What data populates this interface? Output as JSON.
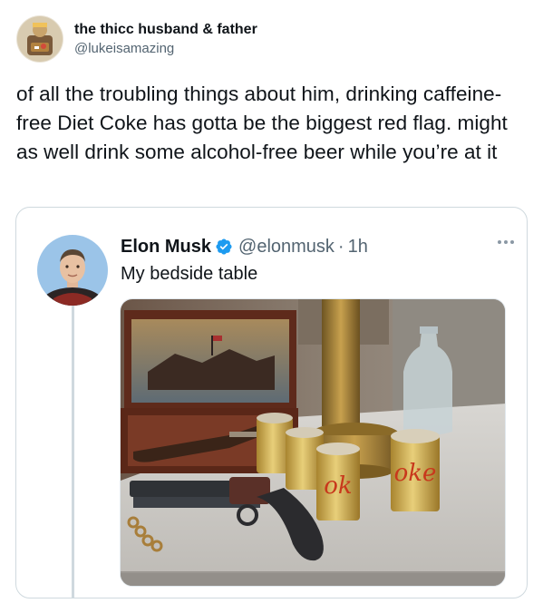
{
  "tweet": {
    "display_name": "the thicc husband & father",
    "handle": "@lukeisamazing",
    "text": "of all the troubling things about him, drinking caffeine-free Diet Coke has gotta be the biggest red flag. might as well drink some alcohol-free beer while you’re at it"
  },
  "quoted": {
    "display_name": "Elon Musk",
    "handle": "@elonmusk",
    "separator": "·",
    "time": "1h",
    "text": "My bedside table",
    "verified_icon": "verified-badge-icon",
    "verified_color": "#1d9bf0"
  },
  "colors": {
    "text_primary": "#0f1419",
    "text_secondary": "#536471",
    "border": "#cfd9de"
  }
}
